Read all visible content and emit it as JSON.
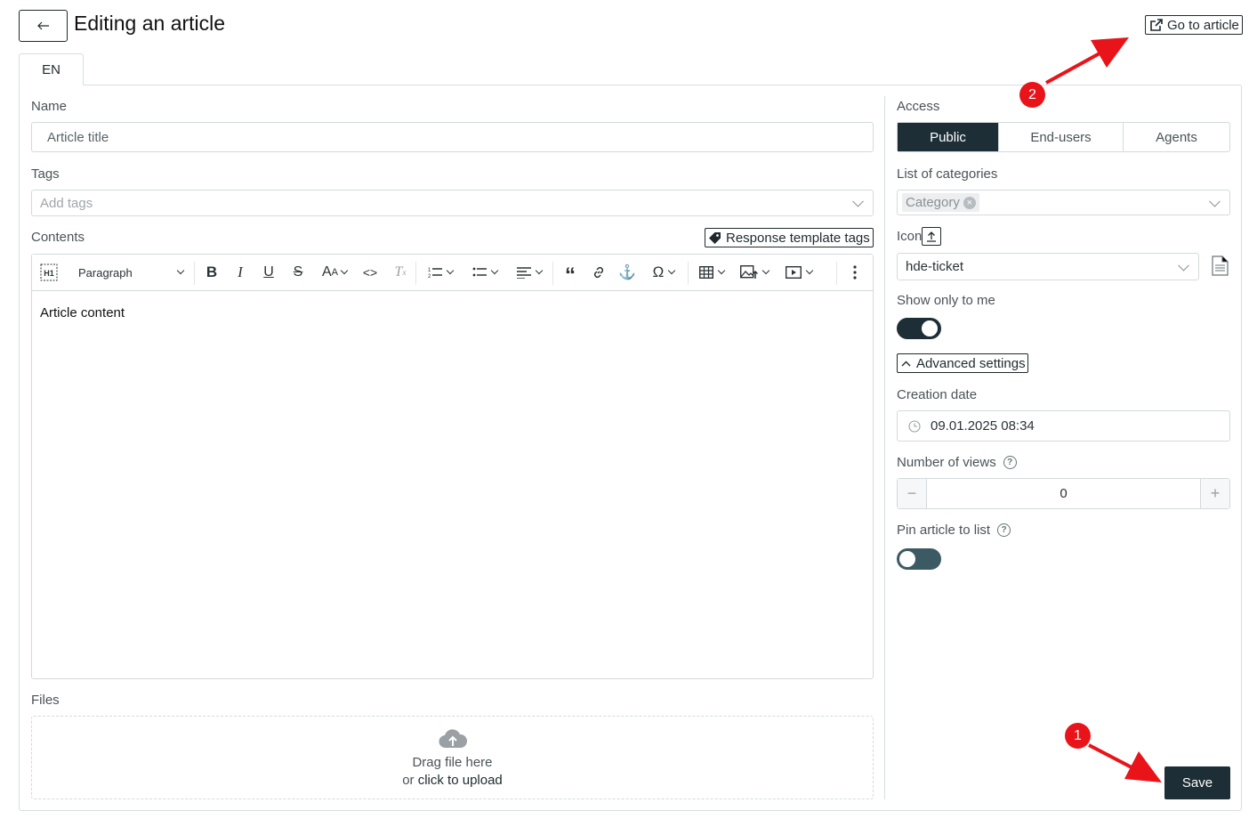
{
  "header": {
    "title": "Editing an article",
    "go_to_article": "Go to article"
  },
  "tabs": [
    {
      "label": "EN",
      "active": true
    }
  ],
  "form": {
    "name": {
      "label": "Name",
      "value": "Article title"
    },
    "tags": {
      "label": "Tags",
      "placeholder": "Add tags"
    },
    "contents": {
      "label": "Contents",
      "response_template_tags": "Response template tags"
    },
    "editor": {
      "block_style": "Paragraph",
      "content": "Article content",
      "tools": [
        "heading-icon",
        "bold-icon",
        "italic-icon",
        "underline-icon",
        "strikethrough-icon",
        "font-size-icon",
        "code-icon",
        "clear-format-icon",
        "numbered-list-icon",
        "bulleted-list-icon",
        "align-icon",
        "blockquote-icon",
        "link-icon",
        "anchor-icon",
        "special-chars-icon",
        "table-icon",
        "image-icon",
        "media-icon",
        "more-icon"
      ]
    },
    "files": {
      "label": "Files",
      "drag_text": "Drag file here",
      "or_text": "or",
      "click_text": "click to upload"
    }
  },
  "sidebar": {
    "access": {
      "label": "Access",
      "options": [
        "Public",
        "End-users",
        "Agents"
      ],
      "selected": "Public"
    },
    "categories": {
      "label": "List of categories",
      "chips": [
        "Category"
      ]
    },
    "icon": {
      "label": "Icon",
      "value": "hde-ticket"
    },
    "show_only_to_me": {
      "label": "Show only to me",
      "enabled": true
    },
    "advanced_settings": "Advanced settings",
    "creation_date": {
      "label": "Creation date",
      "value": "09.01.2025 08:34"
    },
    "views": {
      "label": "Number of views",
      "value": "0",
      "minus": "−",
      "plus": "+"
    },
    "pin": {
      "label": "Pin article to list",
      "enabled": false
    }
  },
  "actions": {
    "save": "Save"
  },
  "annotations": {
    "badge_1": "1",
    "badge_2": "2",
    "color": "#e8141a"
  },
  "colors": {
    "primary": "#1d2e36",
    "border": "#d5d9dc",
    "annotation": "#e8141a"
  }
}
